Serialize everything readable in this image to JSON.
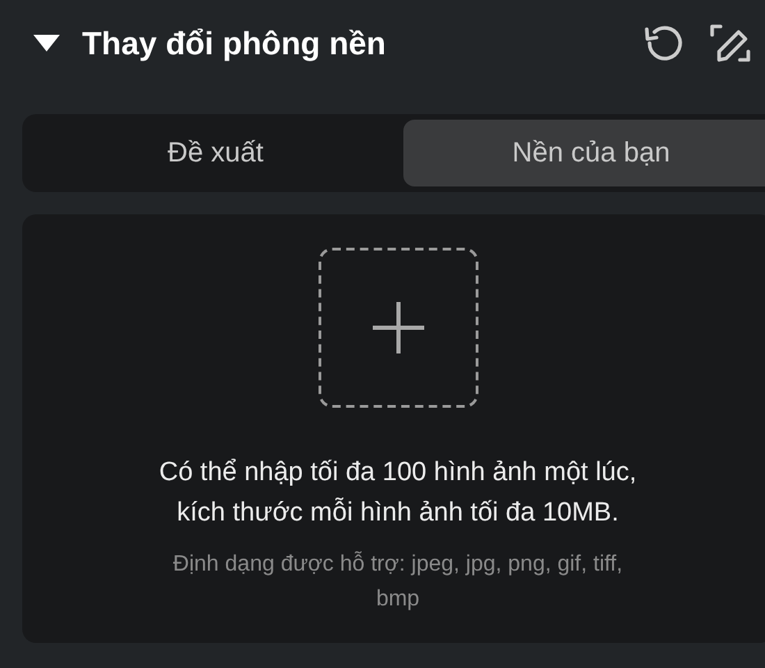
{
  "header": {
    "title": "Thay đổi phông nền",
    "expanded": true
  },
  "tabs": [
    {
      "label": "Đề xuất",
      "selected": false
    },
    {
      "label": "Nền của bạn",
      "selected": true
    }
  ],
  "upload": {
    "message": "Có thể nhập tối đa 100 hình ảnh một lúc, kích thước mỗi hình ảnh tối đa 10MB.",
    "formats": "Định dạng được hỗ trợ: jpeg, jpg, png, gif, tiff, bmp"
  }
}
